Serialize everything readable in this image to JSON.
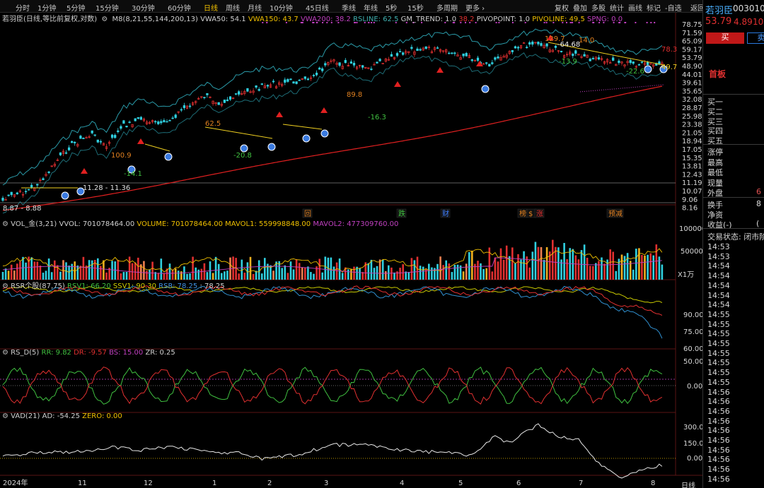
{
  "toolbar": {
    "periods": [
      {
        "label": "分时",
        "selected": false
      },
      {
        "label": "1分钟",
        "selected": false
      },
      {
        "label": "5分钟",
        "selected": false
      },
      {
        "label": "15分钟",
        "selected": false
      },
      {
        "label": "30分钟",
        "selected": false
      },
      {
        "label": "60分钟",
        "selected": false
      },
      {
        "label": "日线",
        "selected": true
      },
      {
        "label": "周线",
        "selected": false
      },
      {
        "label": "月线",
        "selected": false
      },
      {
        "label": "10分钟",
        "selected": false
      },
      {
        "label": "45日线",
        "selected": false
      },
      {
        "label": "季线",
        "selected": false
      },
      {
        "label": "年线",
        "selected": false
      },
      {
        "label": "5秒",
        "selected": false
      },
      {
        "label": "15秒",
        "selected": false
      },
      {
        "label": "多周期",
        "selected": false
      },
      {
        "label": "更多 ›",
        "selected": false
      }
    ],
    "right_buttons": [
      "复权",
      "叠加",
      "多股",
      "统计",
      "画线",
      "标记",
      "-自选",
      "返回"
    ]
  },
  "main_header": {
    "title": "若羽臣(日线,等比前复权,对数)",
    "indicators": [
      {
        "text": "M8(8,21,55,144,200,13)",
        "color": "#d0d0d0"
      },
      {
        "text": "VWA50: 54.1",
        "color": "#d0d0d0"
      },
      {
        "text": "VWA150: 43.7",
        "color": "#f0c000"
      },
      {
        "text": "VWA200: 38.2",
        "color": "#c040c0"
      },
      {
        "text": "RSLINE: 62.5",
        "color": "#40b0b0"
      },
      {
        "text": "GM_TREND: 1.0",
        "color": "#d0d0d0"
      },
      {
        "text": "38.2",
        "color": "#e03030"
      },
      {
        "text": "PIVOPOINT: 1.0",
        "color": "#d0d0d0"
      },
      {
        "text": "PIVOLINE: 49.5",
        "color": "#f0c000"
      },
      {
        "text": "SPNG: 0.0",
        "color": "#c040c0"
      }
    ]
  },
  "price_axis": [
    "78.75",
    "71.59",
    "65.09",
    "59.17",
    "53.79",
    "48.90",
    "44.01",
    "39.61",
    "35.65",
    "32.08",
    "28.87",
    "25.98",
    "23.38",
    "21.05",
    "18.94",
    "17.05",
    "15.35",
    "13.81",
    "12.43",
    "11.19",
    "10.07",
    "9.06",
    "8.16"
  ],
  "price_annotations": [
    "129.7",
    "-64.68",
    "14.0",
    "78.3",
    "-13.9",
    "-22.6",
    "49.7",
    "89.8",
    "-16.3",
    "62.5",
    "-20.8",
    "100.9",
    "-14.1",
    "11.28 - 11.36",
    "8.87 - 8.88"
  ],
  "event_tags": [
    {
      "label": "回",
      "color": "#e08020"
    },
    {
      "label": "跌",
      "color": "#40c040"
    },
    {
      "label": "财",
      "color": "#4080ff"
    },
    {
      "label": "榜",
      "color": "#e08020"
    },
    {
      "label": "$",
      "color": "#e08020"
    },
    {
      "label": "涨",
      "color": "#e03030"
    },
    {
      "label": "预减",
      "color": "#e08020"
    }
  ],
  "volume_header": {
    "title": "VOL_金(3,21)",
    "items": [
      {
        "text": "VVOL: 701078464.00",
        "color": "#d0d0d0"
      },
      {
        "text": "VOLUME: 701078464.00",
        "color": "#f0c000"
      },
      {
        "text": "MAVOL1: 559998848.00",
        "color": "#f0c000"
      },
      {
        "text": "MAVOL2: 477309760.00",
        "color": "#c040c0"
      }
    ]
  },
  "volume_axis": [
    "100000",
    "50000",
    "X1万"
  ],
  "rsr_header": {
    "title": "RSR个股(87,75)",
    "items": [
      {
        "text": "RSV1: 66.20",
        "color": "#40c040"
      },
      {
        "text": "SSV1: 90.30",
        "color": "#d0d000"
      },
      {
        "text": "RSR: 78.25",
        "color": "#4090e0"
      },
      {
        "text": ": 78.25",
        "color": "#d0d0d0"
      }
    ]
  },
  "rsr_axis": [
    "90.00",
    "75.00",
    "60.00"
  ],
  "rsd_header": {
    "title": "RS_D(5)",
    "items": [
      {
        "text": "RR: 9.82",
        "color": "#40c040"
      },
      {
        "text": "DR: -9.57",
        "color": "#e03030"
      },
      {
        "text": "BS: 15.00",
        "color": "#c040c0"
      },
      {
        "text": "ZR: 0.25",
        "color": "#d0d0d0"
      }
    ]
  },
  "rsd_axis": [
    "50.00",
    "0.00"
  ],
  "vad_header": {
    "title": "VAD(21)",
    "items": [
      {
        "text": "AD: -54.25",
        "color": "#d0d0d0"
      },
      {
        "text": "ZERO: 0.00",
        "color": "#f0c000"
      }
    ]
  },
  "vad_axis": [
    "300.0",
    "150.0",
    "0.00"
  ],
  "x_axis": [
    "2024年",
    "11",
    "12",
    "1",
    "2",
    "3",
    "4",
    "5",
    "6",
    "7",
    "8"
  ],
  "period_label": "日线",
  "right_panel": {
    "stock_name": "若羽臣",
    "stock_code": "003010",
    "price": "53.79",
    "change": "4.89",
    "change_pct": "10.",
    "buy_button": "买",
    "sell_button": "卖",
    "board_tag": "首板",
    "bid_labels": [
      "买一",
      "买二",
      "买三",
      "买四",
      "买五"
    ],
    "stat_labels": [
      "涨停",
      "最高",
      "最低",
      "现量",
      "外盘"
    ],
    "stat_values": [
      "",
      "",
      "",
      "",
      "6"
    ],
    "stat2_labels": [
      "换手",
      "净资",
      "收益(-)"
    ],
    "stat2_values": [
      "8",
      "",
      "("
    ],
    "trade_status": "交易状态: 闭市阶",
    "ticks": [
      "14:53",
      "14:53",
      "14:54",
      "14:54",
      "14:54",
      "14:54",
      "14:54",
      "14:55",
      "14:55",
      "14:55",
      "14:55",
      "14:55",
      "14:55",
      "14:55",
      "14:55",
      "14:56",
      "14:56",
      "14:56",
      "14:56",
      "14:56",
      "14:56",
      "14:56",
      "14:56",
      "14:56",
      "14:56",
      "14:56",
      "14:56",
      "14:56",
      "14:56",
      "14:56",
      "14:56",
      "14:56"
    ]
  },
  "colors": {
    "up": "#e03030",
    "down": "#30d0e0",
    "ma_red": "#e02020",
    "band": "#2a9aa8",
    "pivot": "#f0d020",
    "grid": "#3a1010",
    "axis_text": "#d8d8d8"
  }
}
